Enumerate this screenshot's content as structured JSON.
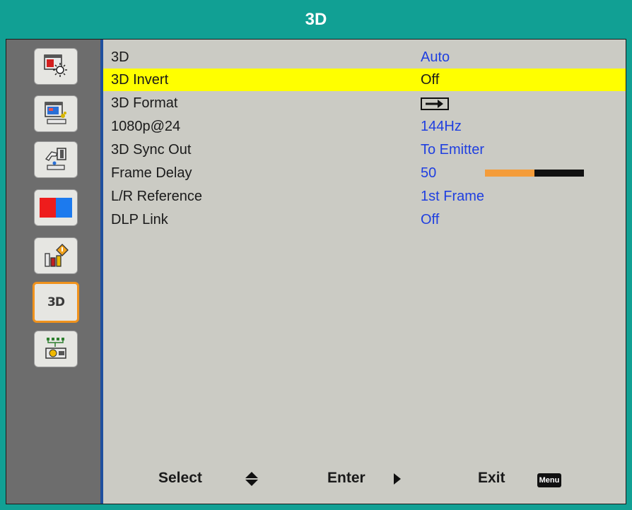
{
  "window": {
    "title": "3D"
  },
  "sidebar": {
    "items": [
      {
        "icon": "picture-brightness-icon"
      },
      {
        "icon": "screen-setup-icon"
      },
      {
        "icon": "setting-hand-icon"
      },
      {
        "icon": "color-icon"
      },
      {
        "icon": "info-chart-icon"
      },
      {
        "icon": "3d-icon",
        "label": "3D",
        "selected": true
      },
      {
        "icon": "network-projector-icon"
      }
    ]
  },
  "menu": {
    "rows": [
      {
        "label": "3D",
        "value": "Auto"
      },
      {
        "label": "3D Invert",
        "value": "Off",
        "highlighted": true
      },
      {
        "label": "3D Format",
        "value": "",
        "value_icon": "arrow-right-box-icon"
      },
      {
        "label": "1080p@24",
        "value": "144Hz"
      },
      {
        "label": "3D Sync Out",
        "value": "To Emitter"
      },
      {
        "label": "Frame Delay",
        "value": "50",
        "level": 0.5
      },
      {
        "label": "L/R Reference",
        "value": "1st Frame"
      },
      {
        "label": "DLP Link",
        "value": "Off"
      }
    ]
  },
  "footer": {
    "select_label": "Select",
    "enter_label": "Enter",
    "exit_label": "Exit",
    "menu_badge": "Menu"
  },
  "colors": {
    "title_bar": "#11a094",
    "highlight": "#ffff00",
    "value_text": "#1f3fe0",
    "selected_outline": "#f0921c",
    "bar_fill": "#f49c3a"
  }
}
